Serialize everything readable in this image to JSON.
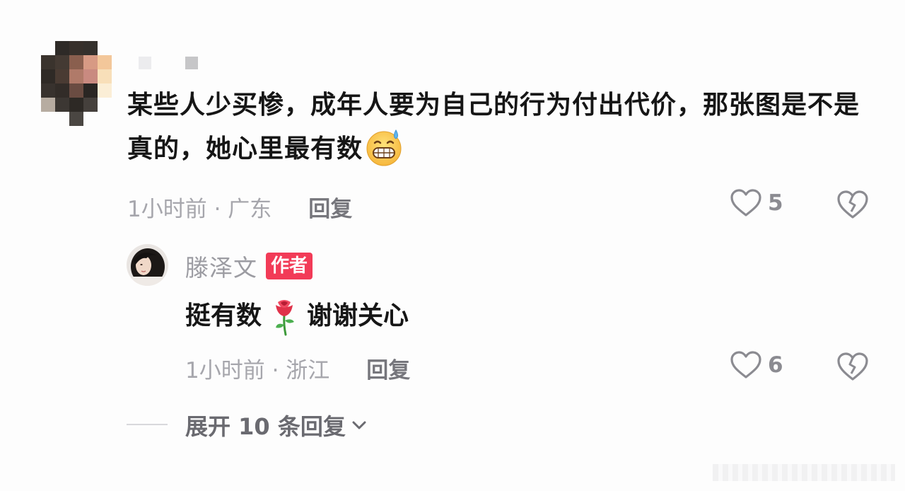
{
  "comment": {
    "avatar_icon": "pixelated-avatar",
    "text": "某些人少买惨，成年人要为自己的行为付出代价，那张图是不是真的，她心里最有数",
    "emoji_icon": "grinning-sweat-emoji",
    "time": "1小时前 · 广东",
    "reply_label": "回复",
    "like_count": "5",
    "like_icon": "heart-icon",
    "dislike_icon": "broken-heart-icon"
  },
  "reply": {
    "username": "滕泽文",
    "badge": "作者",
    "text_before": "挺有数",
    "emoji_icon": "rose-emoji",
    "text_after": "谢谢关心",
    "time": "1小时前 · 浙江",
    "reply_label": "回复",
    "like_count": "6",
    "like_icon": "heart-icon",
    "dislike_icon": "broken-heart-icon"
  },
  "expand": {
    "label": "展开 10 条回复",
    "icon": "chevron-down-icon"
  },
  "colors": {
    "badge": "#f23b57",
    "text": "#161616",
    "meta": "#a6a6ac"
  }
}
